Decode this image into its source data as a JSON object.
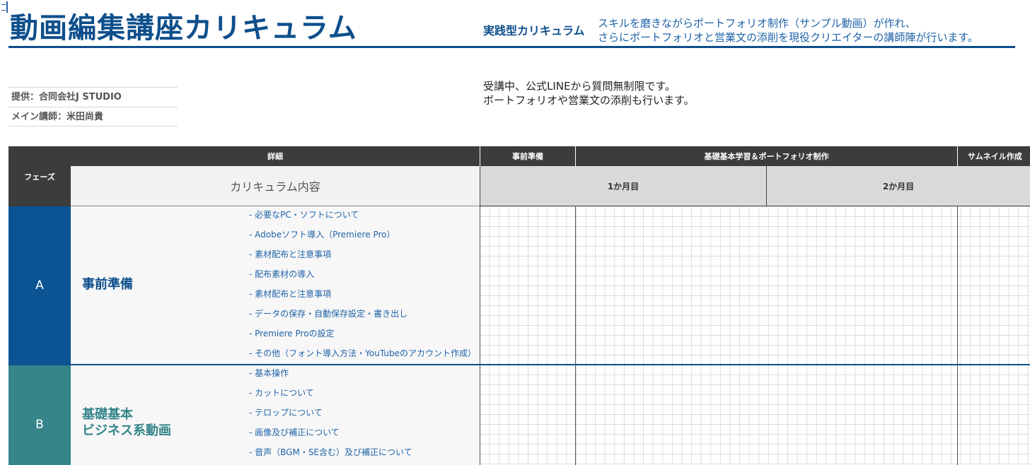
{
  "header": {
    "title": "動画編集講座カリキュラム",
    "subtitle": "実践型カリキュラム",
    "intro_line1": "スキルを磨きながらポートフォリオ制作（サンプル動画）が作れ、",
    "intro_line2": "さらにポートフォリオと営業文の添削を現役クリエイターの講師陣が行います。"
  },
  "credits": {
    "provider": "提供：合同会社J STUDIO",
    "instructor": "メイン講師：米田尚貴"
  },
  "note": {
    "line1": "受講中、公式LINEから質問無制限です。",
    "line2": "ポートフォリオや営業文の添削も行います。"
  },
  "table": {
    "phase_header": "フェーズ",
    "detail_header": "詳細",
    "content_header": "カリキュラム内容",
    "stages": [
      {
        "label": "事前準備"
      },
      {
        "label": "基礎基本学習＆ポートフォリオ制作"
      },
      {
        "label": "サムネイル作成"
      }
    ],
    "months": [
      {
        "label": "1か月目"
      },
      {
        "label": "2か月目"
      }
    ],
    "phases": [
      {
        "letter": "A",
        "name": "事前準備",
        "color": "#0a5494",
        "items": [
          "- 必要なPC・ソフトについて",
          "- Adobeソフト導入（Premiere Pro）",
          "- 素材配布と注意事項",
          "- 配布素材の導入",
          "- 素材配布と注意事項",
          "- データの保存・自動保存設定・書き出し",
          "- Premiere Proの設定",
          "- その他（フォント導入方法・YouTubeのアカウント作成）"
        ]
      },
      {
        "letter": "B",
        "name": "基礎基本\nビジネス系動画",
        "color": "#35858a",
        "items": [
          "- 基本操作",
          "- カットについて",
          "- テロップについて",
          "- 画像及び補正について",
          "- 音声（BGM・SE含む）及び補正について"
        ]
      }
    ]
  },
  "colors": {
    "brand_blue": "#0e4f8c",
    "phase_a": "#0a5494",
    "phase_b": "#35858a",
    "header_dark": "#3c3c3c"
  }
}
